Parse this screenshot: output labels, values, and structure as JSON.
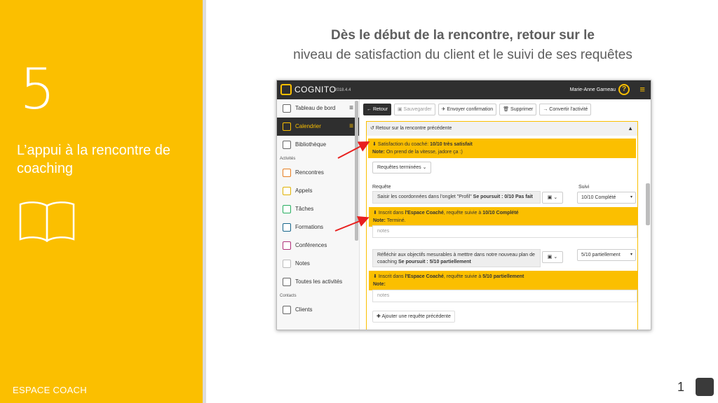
{
  "slide": {
    "number_big": "5",
    "subtitle": "L’appui à la rencontre de coaching",
    "footer": "ESPACE COACH",
    "headline_bold": "Dès le début de la rencontre, retour sur le",
    "headline_regular": "niveau de satisfaction du client et le suivi de ses requêtes",
    "page_number": "1"
  },
  "app": {
    "brand": "COGNITO",
    "version": "2018.4.4",
    "user": "Marie-Anne Garneau",
    "help_glyph": "?",
    "menu_glyph": "≡",
    "sidebar": {
      "items_top": [
        {
          "label": "Tableau de bord",
          "icon": "home-icon"
        },
        {
          "label": "Calendrier",
          "icon": "calendar-icon",
          "active": true
        },
        {
          "label": "Bibliothèque",
          "icon": "library-icon"
        }
      ],
      "section_activites": "Activités",
      "items_activites": [
        {
          "label": "Rencontres",
          "icon": "meeting-icon"
        },
        {
          "label": "Appels",
          "icon": "phone-icon"
        },
        {
          "label": "Tâches",
          "icon": "tasks-icon"
        },
        {
          "label": "Formations",
          "icon": "training-icon"
        },
        {
          "label": "Conférences",
          "icon": "conference-icon"
        },
        {
          "label": "Notes",
          "icon": "notes-icon"
        },
        {
          "label": "Toutes les activités",
          "icon": "all-activities-icon"
        }
      ],
      "section_contacts": "Contacts",
      "items_contacts": [
        {
          "label": "Clients",
          "icon": "clients-icon"
        }
      ]
    },
    "toolbar": {
      "retour": "Retour",
      "sauvegarder": "Sauvegarder",
      "envoyer": "Envoyer confirmation",
      "supprimer": "Supprimer",
      "convertir": "Convertir l'activité"
    },
    "panel": {
      "title": "Retour sur la rencontre précédente",
      "satisfaction_prefix": "Satisfaction du coaché:",
      "satisfaction_value": "10/10 très satisfait",
      "note_label": "Note:",
      "note_text": "On prend de la vitesse, jadore ça :)",
      "requests_button": "Requêtes terminées",
      "col_requete": "Requête",
      "col_suivi": "Suivi",
      "request1": {
        "text": "Saisir les coordonnées dans l'onglet \"Profil\"",
        "pursue_label": "Se poursuit : 0/10 Pas fait",
        "select_value": "10/10 Complété",
        "notice_prefix": "Inscrit dans",
        "notice_place": "l'Espace Coaché",
        "notice_mid": ", requête suivie à",
        "notice_value": "10/10 Complété",
        "note_label": "Note:",
        "note_text": "Terminé.",
        "notes_placeholder": "notes"
      },
      "request2": {
        "text": "Réfléchir aux objectifs mesurables à metttre dans notre nouveau plan de coaching",
        "pursue_label": "Se poursuit : 5/10 partiellement",
        "select_value": "5/10 partiellement",
        "notice_prefix": "Inscrit dans",
        "notice_place": "l'Espace Coaché",
        "notice_mid": ", requête suivie à",
        "notice_value": "5/10 partiellement",
        "note_label": "Note:",
        "notes_placeholder": "notes"
      },
      "add_button": "Ajouter une requête précédente"
    }
  },
  "colors": {
    "accent_yellow": "#fbbf00",
    "dark": "#2f2f2f",
    "arrow_red": "#e8201f"
  }
}
